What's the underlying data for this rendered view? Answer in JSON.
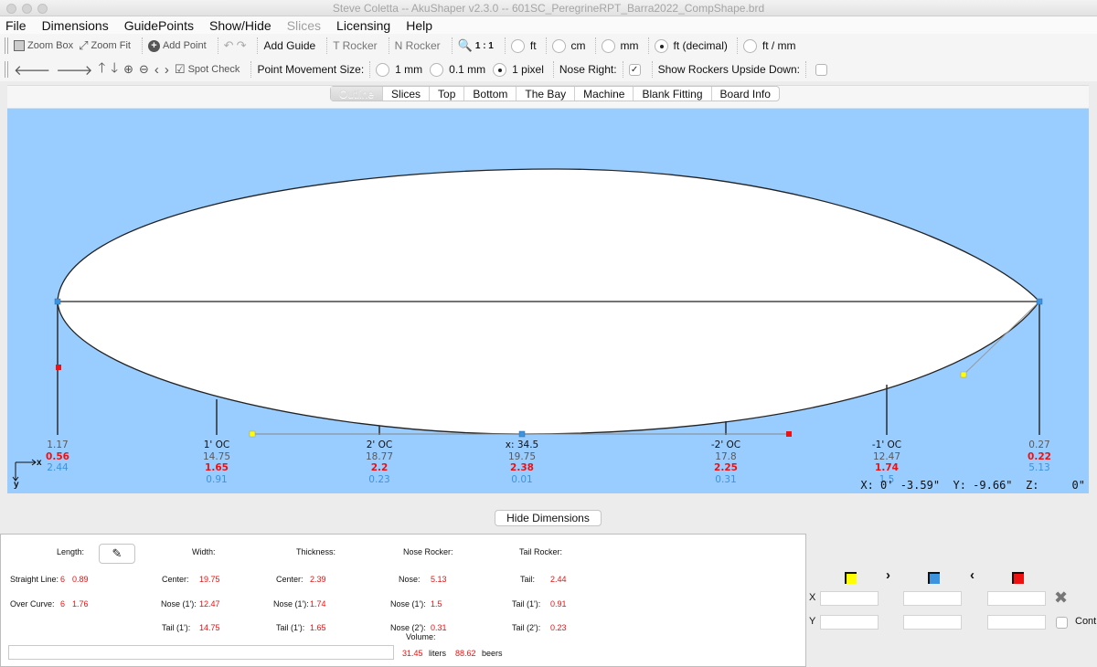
{
  "window": {
    "title": "Steve Coletta -- AkuShaper v2.3.0  --  601SC_PeregrineRPT_Barra2022_CompShape.brd"
  },
  "menu": [
    "File",
    "Dimensions",
    "GuidePoints",
    "Show/Hide",
    "Slices",
    "Licensing",
    "Help"
  ],
  "menu_disabled": [
    "Slices"
  ],
  "toolbar1": {
    "zoom_box": "Zoom Box",
    "zoom_fit": "Zoom Fit",
    "add_point": "Add Point",
    "add_guide": "Add Guide",
    "t_rocker": "T Rocker",
    "n_rocker": "N Rocker",
    "scale": "1 : 1",
    "units": [
      {
        "label": "ft",
        "selected": false
      },
      {
        "label": "cm",
        "selected": false
      },
      {
        "label": "mm",
        "selected": false
      },
      {
        "label": "ft (decimal)",
        "selected": true
      },
      {
        "label": "ft / mm",
        "selected": false
      }
    ]
  },
  "toolbar2": {
    "spot_check": "Spot Check",
    "point_movement_label": "Point Movement Size:",
    "movement_sizes": [
      {
        "label": "1 mm",
        "selected": false
      },
      {
        "label": "0.1 mm",
        "selected": false
      },
      {
        "label": "1 pixel",
        "selected": true
      }
    ],
    "nose_right_label": "Nose Right:",
    "nose_right_checked": true,
    "rockers_upside_label": "Show Rockers Upside Down:",
    "rockers_upside_checked": false
  },
  "tabs": [
    {
      "label": "Outline",
      "active": true
    },
    {
      "label": "Slices",
      "active": false
    },
    {
      "label": "Top",
      "active": false
    },
    {
      "label": "Bottom",
      "active": false
    },
    {
      "label": "The Bay",
      "active": false
    },
    {
      "label": "Machine",
      "active": false
    },
    {
      "label": "Blank Fitting",
      "active": false
    },
    {
      "label": "Board Info",
      "active": false
    }
  ],
  "canvas": {
    "colors": {
      "background": "#99ccff",
      "board": "#ffffff",
      "yellow": "#ffff00",
      "blue": "#3d93dd",
      "red": "#ee1111"
    },
    "stations": [
      {
        "heading": "",
        "values": [
          "1.17",
          "0.56",
          "2.44"
        ]
      },
      {
        "heading": "1' OC",
        "values": [
          "14.75",
          "1.65",
          "0.91"
        ]
      },
      {
        "heading": "2' OC",
        "values": [
          "18.77",
          "2.2",
          "0.23"
        ]
      },
      {
        "heading": "x: 34.5",
        "values": [
          "19.75",
          "2.38",
          "0.01"
        ]
      },
      {
        "heading": "-2' OC",
        "values": [
          "17.8",
          "2.25",
          "0.31"
        ]
      },
      {
        "heading": "-1' OC",
        "values": [
          "12.47",
          "1.74",
          "1.5"
        ]
      },
      {
        "heading": "",
        "values": [
          "0.27",
          "0.22",
          "5.13"
        ]
      }
    ],
    "axis_x": "x",
    "axis_y": "y",
    "cursor_readout": "X: 0' -3.59\"  Y: -9.66\"  Z:     0\""
  },
  "hide_dimensions": "Hide Dimensions",
  "dimensions": {
    "length_label": "Length:",
    "width_label": "Width:",
    "thickness_label": "Thickness:",
    "nose_rocker_label": "Nose Rocker:",
    "tail_rocker_label": "Tail Rocker:",
    "straight_line_label": "Straight Line:",
    "straight_line_ft": "6",
    "straight_line_in": "0.89",
    "over_curve_label": "Over Curve:",
    "over_curve_ft": "6",
    "over_curve_in": "1.76",
    "width_center_label": "Center:",
    "width_center": "19.75",
    "width_nose_label": "Nose (1'):",
    "width_nose": "12.47",
    "width_tail_label": "Tail (1'):",
    "width_tail": "14.75",
    "thick_center_label": "Center:",
    "thick_center": "2.39",
    "thick_nose_label": "Nose (1'):",
    "thick_nose": "1.74",
    "thick_tail_label": "Tail (1'):",
    "thick_tail": "1.65",
    "nr_nose_label": "Nose:",
    "nr_nose": "5.13",
    "nr_nose1_label": "Nose (1'):",
    "nr_nose1": "1.5",
    "nr_nose2_label": "Nose (2'):",
    "nr_nose2": "0.31",
    "tr_tail_label": "Tail:",
    "tr_tail": "2.44",
    "tr_tail1_label": "Tail (1'):",
    "tr_tail1": "0.91",
    "tr_tail2_label": "Tail (2'):",
    "tr_tail2": "0.23",
    "volume_label": "Volume:",
    "volume_liters": "31.45",
    "liters_label": "liters",
    "volume_beers": "88.62",
    "beers_label": "beers",
    "volume_input": ""
  },
  "point_editor": {
    "x_label": "X",
    "y_label": "Y",
    "cont_label": "Cont",
    "cont_checked": false,
    "x_values": [
      "",
      "",
      ""
    ],
    "y_values": [
      "",
      "",
      ""
    ]
  }
}
